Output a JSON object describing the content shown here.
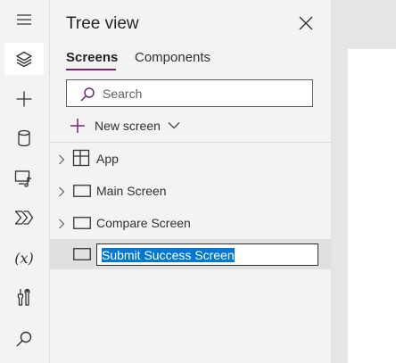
{
  "rail": {
    "items": [
      {
        "icon": "hamburger-menu-icon"
      },
      {
        "icon": "layers-icon",
        "active": true
      },
      {
        "icon": "plus-icon"
      },
      {
        "icon": "database-icon"
      },
      {
        "icon": "media-icon"
      },
      {
        "icon": "power-automate-icon"
      },
      {
        "icon": "variables-icon",
        "text": "(x)"
      },
      {
        "icon": "advanced-tools-icon"
      },
      {
        "icon": "search-icon"
      }
    ]
  },
  "panel": {
    "title": "Tree view",
    "tabs": [
      {
        "label": "Screens",
        "active": true
      },
      {
        "label": "Components",
        "active": false
      }
    ],
    "search": {
      "placeholder": "Search",
      "value": ""
    },
    "new_screen_label": "New screen",
    "tree": [
      {
        "label": "App",
        "icon": "app-icon",
        "expandable": true
      },
      {
        "label": "Main Screen",
        "icon": "screen-icon",
        "expandable": true
      },
      {
        "label": "Compare Screen",
        "icon": "screen-icon",
        "expandable": true
      },
      {
        "label": "Submit Success Screen",
        "icon": "screen-icon",
        "expandable": false,
        "selected": true,
        "renaming": true
      }
    ]
  },
  "colors": {
    "accent": "#742774",
    "selection": "#0078d4",
    "panel_bg": "#f3f3f3"
  }
}
